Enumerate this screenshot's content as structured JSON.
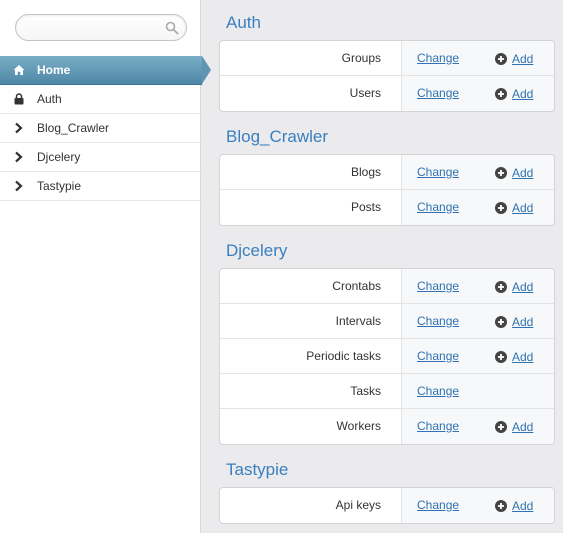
{
  "search": {
    "placeholder": "",
    "value": ""
  },
  "sidebar": {
    "items": [
      {
        "label": "Home",
        "icon": "home-icon",
        "active": true
      },
      {
        "label": "Auth",
        "icon": "lock-icon",
        "active": false
      },
      {
        "label": "Blog_Crawler",
        "icon": "chevron-right-icon",
        "active": false
      },
      {
        "label": "Djcelery",
        "icon": "chevron-right-icon",
        "active": false
      },
      {
        "label": "Tastypie",
        "icon": "chevron-right-icon",
        "active": false
      }
    ]
  },
  "modules": [
    {
      "title": "Auth",
      "rows": [
        {
          "name": "Groups",
          "change": "Change",
          "add": "Add"
        },
        {
          "name": "Users",
          "change": "Change",
          "add": "Add"
        }
      ]
    },
    {
      "title": "Blog_Crawler",
      "rows": [
        {
          "name": "Blogs",
          "change": "Change",
          "add": "Add"
        },
        {
          "name": "Posts",
          "change": "Change",
          "add": "Add"
        }
      ]
    },
    {
      "title": "Djcelery",
      "rows": [
        {
          "name": "Crontabs",
          "change": "Change",
          "add": "Add"
        },
        {
          "name": "Intervals",
          "change": "Change",
          "add": "Add"
        },
        {
          "name": "Periodic tasks",
          "change": "Change",
          "add": "Add"
        },
        {
          "name": "Tasks",
          "change": "Change",
          "add": null
        },
        {
          "name": "Workers",
          "change": "Change",
          "add": "Add"
        }
      ]
    },
    {
      "title": "Tastypie",
      "rows": [
        {
          "name": "Api keys",
          "change": "Change",
          "add": "Add"
        }
      ]
    }
  ],
  "colors": {
    "accent": "#3a7fc0",
    "link": "#3072b3",
    "active_nav": "#5d95b2",
    "background": "#ebebed"
  }
}
